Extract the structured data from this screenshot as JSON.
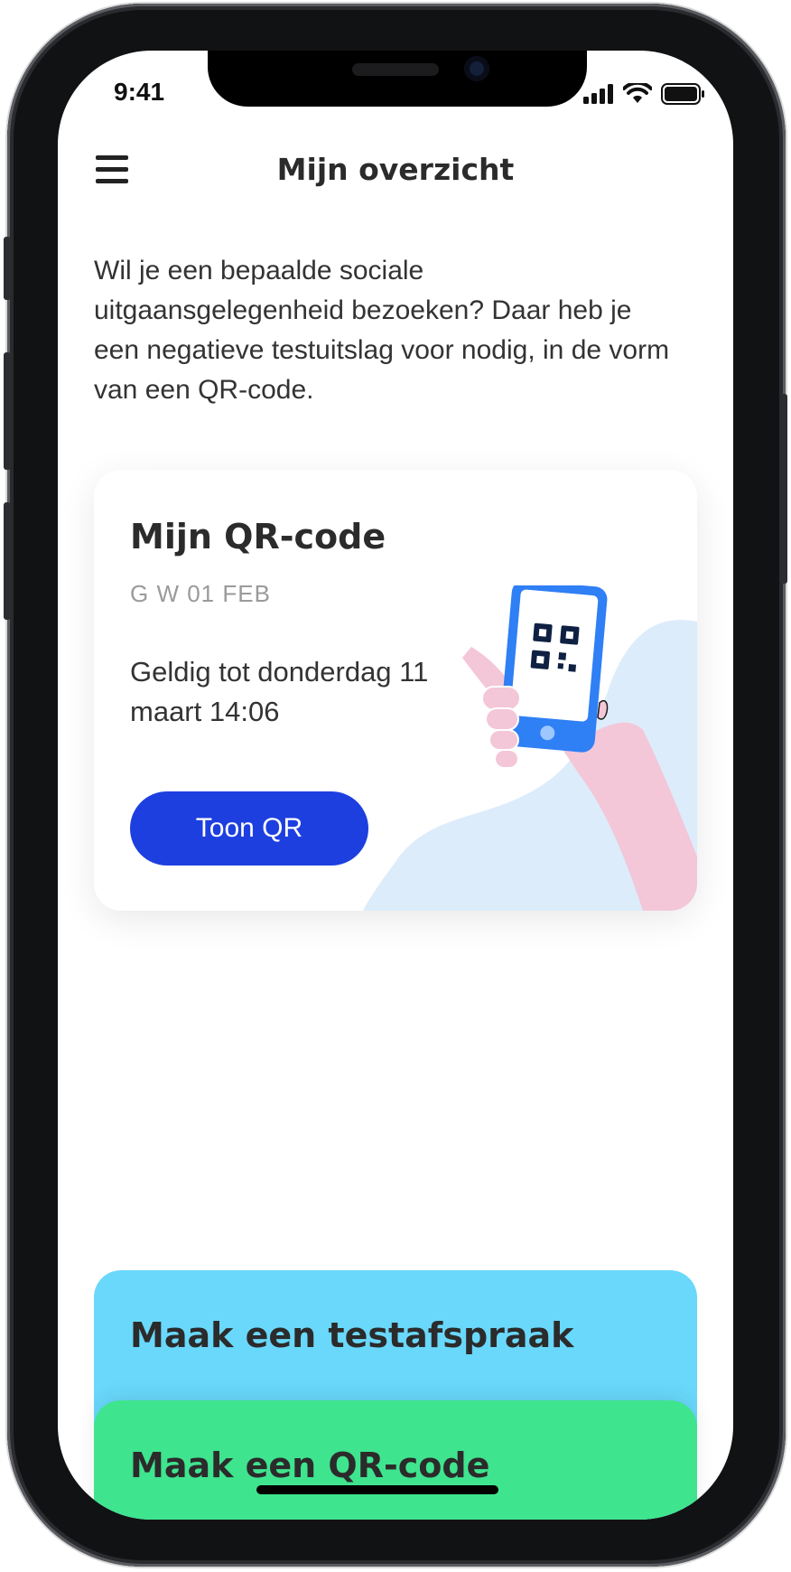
{
  "status_bar": {
    "time": "9:41",
    "icons": [
      "cellular-signal-icon",
      "wifi-icon",
      "battery-icon"
    ]
  },
  "header": {
    "title": "Mijn overzicht",
    "menu_icon": "hamburger-menu-icon"
  },
  "intro_text": "Wil je een bepaalde sociale uitgaansgelegenheid bezoeken? Daar heb je een negatieve testuitslag voor nodig, in de vorm van een QR-code.",
  "qr_card": {
    "title": "Mijn QR-code",
    "subtitle": "G W 01 FEB",
    "validity": "Geldig tot donderdag 11 maart 14:06",
    "button_label": "Toon QR",
    "illustration": "hand-holding-phone-qr-illustration"
  },
  "action_cards": [
    {
      "label": "Maak een testafspraak",
      "color": "#69d8fb"
    },
    {
      "label": "Maak een QR-code",
      "color": "#3fe48e"
    }
  ],
  "colors": {
    "primary_button": "#1d3fe0",
    "text": "#2b2b2b",
    "muted_text": "#9a9a9a",
    "illustration_blob": "#dcecfb",
    "hand": "#f3c7d8"
  }
}
